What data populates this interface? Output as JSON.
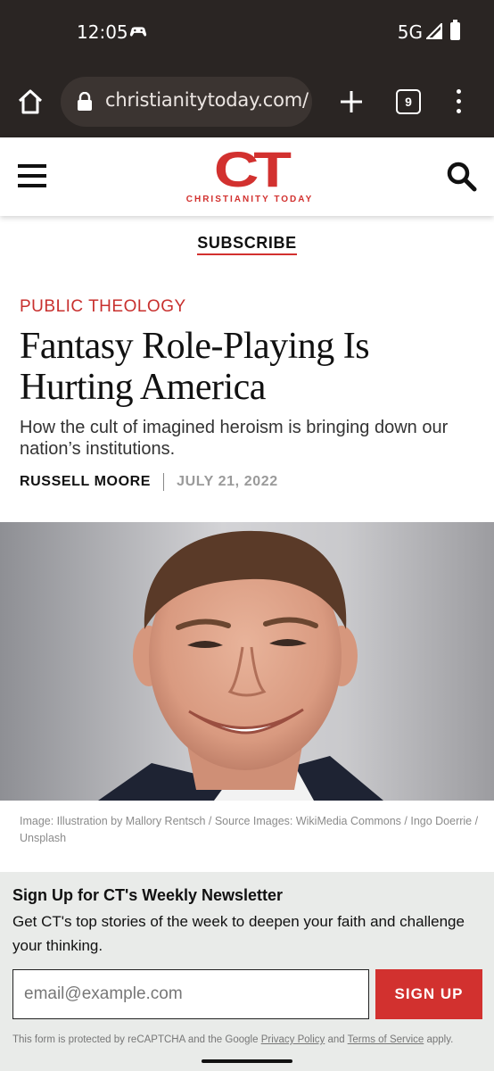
{
  "status_bar": {
    "time": "12:05",
    "network": "5G"
  },
  "browser": {
    "url": "christianitytoday.com/",
    "tab_count": "9"
  },
  "site": {
    "logo_mark": "CT",
    "logo_name": "CHRISTIANITY TODAY",
    "subscribe_label": "SUBSCRIBE"
  },
  "article": {
    "category": "PUBLIC THEOLOGY",
    "headline": "Fantasy Role-Playing Is Hurting America",
    "dek": "How the cult of imagined heroism is bringing down our nation’s institutions.",
    "author": "RUSSELL MOORE",
    "date": "JULY 21, 2022",
    "image_caption": "Image: Illustration by Mallory Rentsch / Source Images: WikiMedia Commons / Ingo Doerrie / Unsplash"
  },
  "newsletter": {
    "title": "Sign Up for CT's Weekly Newsletter",
    "description": "Get CT's top stories of the week to deepen your faith and challenge your thinking.",
    "email_placeholder": "email@example.com",
    "button_label": "SIGN UP",
    "legal_prefix": "This form is protected by reCAPTCHA and the Google",
    "privacy_link": "Privacy Policy",
    "legal_and": "and",
    "terms_link": "Terms of Service",
    "legal_suffix": "apply."
  },
  "colors": {
    "brand_red": "#d2312f",
    "browser_chrome": "#2a2523"
  },
  "icons": [
    "home-icon",
    "lock-icon",
    "plus-icon",
    "tab-switcher-icon",
    "more-vert-icon",
    "hamburger-icon",
    "search-icon"
  ]
}
